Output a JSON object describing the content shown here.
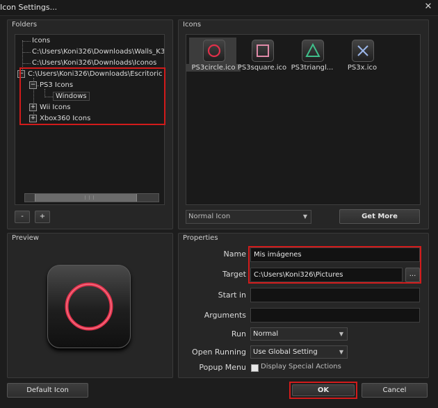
{
  "window": {
    "title": "Icon Settings...",
    "close_glyph": "✕"
  },
  "folders": {
    "title": "Folders",
    "items": [
      {
        "label": "Icons",
        "indent": 0
      },
      {
        "label": "C:\\Users\\Koni326\\Downloads\\Walls_K3",
        "indent": 0
      },
      {
        "label": "C:\\Users\\Koni326\\Downloads\\Iconos",
        "indent": 0
      },
      {
        "label": "C:\\Users\\Koni326\\Downloads\\Escritoric",
        "indent": 0,
        "expander": "−"
      },
      {
        "label": "PS3 Icons",
        "indent": 1,
        "expander": "−"
      },
      {
        "label": "Windows",
        "indent": 2
      },
      {
        "label": "Wii Icons",
        "indent": 1,
        "expander": "+"
      },
      {
        "label": "Xbox360 Icons",
        "indent": 1,
        "expander": "+"
      }
    ],
    "remove_label": "-",
    "add_label": "+"
  },
  "icons": {
    "title": "Icons",
    "items": [
      {
        "label": "PS3circle.ico",
        "selected": true,
        "shape": "circle-icon",
        "color": "#e0304a"
      },
      {
        "label": "PS3square.ico",
        "selected": false,
        "shape": "square-icon",
        "color": "#e08aa8"
      },
      {
        "label": "PS3triangl...",
        "selected": false,
        "shape": "triangle-icon",
        "color": "#3fbf8a"
      },
      {
        "label": "PS3x.ico",
        "selected": false,
        "shape": "x-icon",
        "color": "#9bb6ea"
      }
    ],
    "type_select": "Normal Icon",
    "get_more_label": "Get More"
  },
  "preview": {
    "title": "Preview"
  },
  "properties": {
    "title": "Properties",
    "name_label": "Name",
    "name_value": "Mis imágenes",
    "target_label": "Target",
    "target_value": "C:\\Users\\Koni326\\Pictures",
    "browse_label": "...",
    "start_in_label": "Start in",
    "start_in_value": "",
    "arguments_label": "Arguments",
    "arguments_value": "",
    "run_label": "Run",
    "run_value": "Normal",
    "open_running_label": "Open Running",
    "open_running_value": "Use Global Setting",
    "popup_menu_label": "Popup Menu",
    "popup_menu_checkbox_label": "Display Special Actions"
  },
  "footer": {
    "default_icon_label": "Default Icon",
    "ok_label": "OK",
    "cancel_label": "Cancel"
  },
  "colors": {
    "highlight_red": "#d21b1b",
    "preview_ring": "#e0304a"
  }
}
